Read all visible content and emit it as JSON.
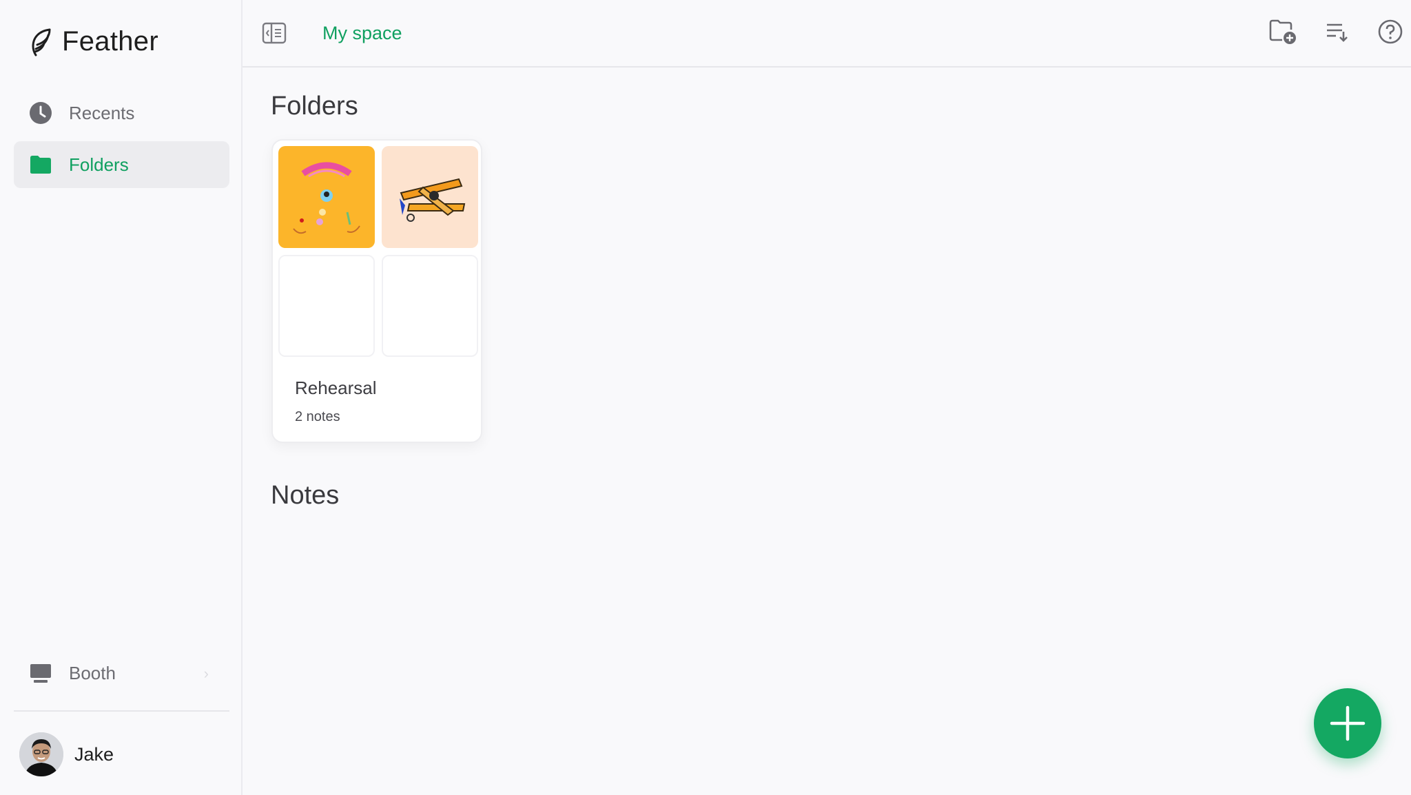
{
  "app": {
    "name": "Feather"
  },
  "sidebar": {
    "items": [
      {
        "label": "Recents",
        "icon": "clock-icon"
      },
      {
        "label": "Folders",
        "icon": "folder-icon",
        "active": true
      }
    ],
    "booth": {
      "label": "Booth",
      "icon": "monitor-icon"
    },
    "user": {
      "name": "Jake"
    }
  },
  "topbar": {
    "breadcrumb": "My space",
    "actions": [
      "new-folder-icon",
      "sort-icon",
      "help-icon"
    ]
  },
  "main": {
    "folders_title": "Folders",
    "notes_title": "Notes",
    "folders": [
      {
        "name": "Rehearsal",
        "count": "2 notes"
      }
    ]
  },
  "colors": {
    "accent": "#14a862",
    "accent_text": "#10a060",
    "thumb_yellow": "#fcb52a",
    "thumb_peach": "#fde3cf"
  }
}
